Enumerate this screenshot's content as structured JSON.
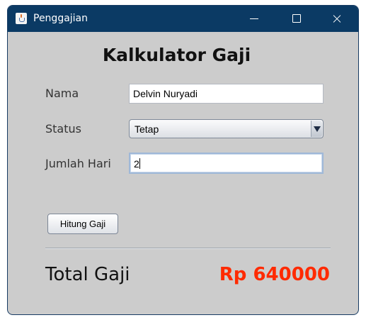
{
  "window": {
    "title": "Penggajian",
    "icon": "java-cup-icon"
  },
  "form": {
    "heading": "Kalkulator Gaji",
    "nama_label": "Nama",
    "nama_value": "Delvin Nuryadi",
    "status_label": "Status",
    "status_selected": "Tetap",
    "hari_label": "Jumlah Hari",
    "hari_value": "2",
    "calc_button": "Hitung Gaji"
  },
  "result": {
    "total_label": "Total Gaji",
    "total_value": "Rp 640000"
  },
  "colors": {
    "titlebar": "#0b3a64",
    "panel": "#cccccc",
    "total_value": "#ff2a00"
  }
}
